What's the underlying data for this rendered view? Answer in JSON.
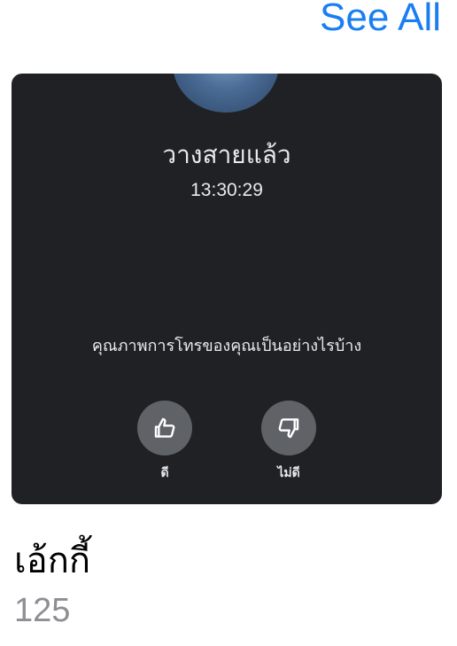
{
  "header": {
    "see_all_label": "See All"
  },
  "card": {
    "call_status": "วางสายแล้ว",
    "call_time": "13:30:29",
    "quality_question": "คุณภาพการโทรของคุณเป็นอย่างไรบ้าง",
    "good_label": "ดี",
    "bad_label": "ไม่ดี",
    "icons": [
      "avatar",
      "thumbs-up-icon",
      "thumbs-down-icon"
    ]
  },
  "contact": {
    "name": "เอ้กกี้",
    "count": "125"
  },
  "colors": {
    "accent": "#1a7ef2",
    "card_bg": "#202124",
    "button_bg": "#5f6368",
    "muted_text": "#8e8e93"
  }
}
